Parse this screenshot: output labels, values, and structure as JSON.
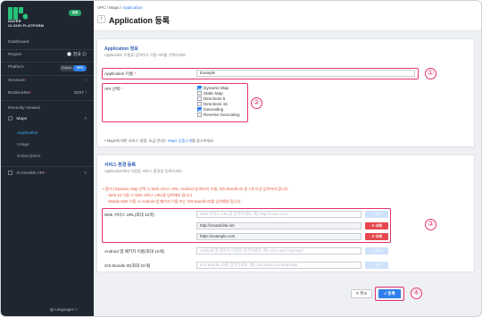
{
  "sidebar": {
    "region_badge": "공공",
    "logo_line1": "NAVER",
    "logo_line2": "CLOUD PLATFORM",
    "dashboard": "Dashboard",
    "region_label": "Region",
    "region_value": "한국",
    "platform_label": "Platform",
    "platform_classic": "Classic",
    "platform_vpc": "VPC",
    "services": "Services",
    "bookmarks": "Bookmarks",
    "bookmarks_edit": "EDIT",
    "recently_viewed": "Recently Viewed",
    "maps": "Maps",
    "maps_items": [
      "Application",
      "Usage",
      "Subscription"
    ],
    "ai_naver_api": "AI·NAVER API",
    "languages": "Languages"
  },
  "header": {
    "breadcrumb": [
      "VPC",
      "Maps",
      "Application"
    ],
    "title": "Application 등록"
  },
  "app_info": {
    "title": "Application 정보",
    "desc": "Application 이름을 입력하고 이용 API를 선택하세요.",
    "name_label": "Application 이름",
    "name_value": "Example",
    "api_label": "API 선택",
    "apis": [
      {
        "label": "Dynamic Map",
        "checked": true
      },
      {
        "label": "Static Map",
        "checked": false
      },
      {
        "label": "Directions 5",
        "checked": false
      },
      {
        "label": "Directions 15",
        "checked": false
      },
      {
        "label": "Geocoding",
        "checked": true
      },
      {
        "label": "Reverse Geocoding",
        "checked": false
      }
    ],
    "note_prefix": "• Maps에 대한 서비스 설명, 요금 안내는",
    "note_link": "Maps 상품소개",
    "note_suffix": "를 참고하세요."
  },
  "env": {
    "title": "서비스 환경 등록",
    "desc": "Application에서 이용할 서비스 환경을 등록하세요.",
    "warnings": [
      "• [필수] Dynamic Map 선택 시 Web 서비스 URL, Android 앱 패키지 이름, iOS Bundle ID 중 1개 이상 입력하여 합니다.",
      "- Web JS 이용 시 Web 서비스 URL을 입력해야 합니다.",
      "- Mobile SDK 이용 시 Android 앱 패키지 이름 또는 iOS Bundle ID를 입력해야 합니다."
    ],
    "web_label": "Web 서비스 URL(최대 10개)",
    "web_placeholder": "Web 서비스 URL을 입력하세요. 예) http://naver.com",
    "web_urls": [
      "http://creatorlink.net",
      "https://example.com"
    ],
    "android_label": "Android 앱 패키지 이름(최대 10개)",
    "android_placeholder": "Android 앱 패키지 이름을 입력하세요. 예) com.naver.mymaps",
    "ios_label": "iOS Bundle ID(최대 10개)",
    "ios_placeholder": "iOS Bundle ID를 입력하세요. 예) com.naver.ios.MapsApp",
    "add_label": "+ 추가",
    "delete_label": "✕ 삭제"
  },
  "footer": {
    "cancel": "✕ 취소",
    "submit": "✓ 등록"
  },
  "callouts": [
    "①",
    "②",
    "③",
    "④"
  ]
}
